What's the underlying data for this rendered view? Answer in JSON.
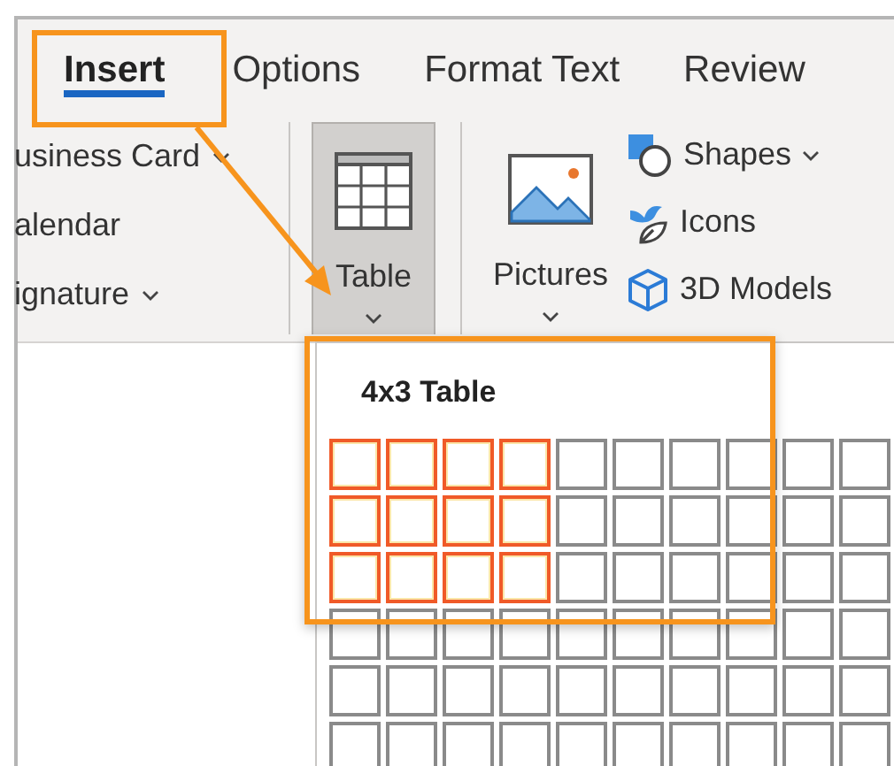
{
  "tabs": [
    {
      "label": "Insert",
      "selected": true
    },
    {
      "label": "Options",
      "selected": false
    },
    {
      "label": "Format Text",
      "selected": false
    },
    {
      "label": "Review",
      "selected": false
    }
  ],
  "left_group": [
    {
      "label": "usiness Card",
      "has_dropdown": true
    },
    {
      "label": "alendar",
      "has_dropdown": false
    },
    {
      "label": "ignature",
      "has_dropdown": true
    }
  ],
  "large_buttons": [
    {
      "label": "Table",
      "kind": "table",
      "pressed": true
    },
    {
      "label": "Pictures",
      "kind": "pictures",
      "pressed": false
    }
  ],
  "small_buttons": [
    {
      "label": "Shapes",
      "kind": "shapes",
      "has_dropdown": true
    },
    {
      "label": "Icons",
      "kind": "icons",
      "has_dropdown": false
    },
    {
      "label": "3D Models",
      "kind": "cube",
      "has_dropdown": false
    }
  ],
  "table_dropdown": {
    "title": "4x3 Table",
    "rows": [
      {
        "selected": [
          true,
          true,
          true,
          true,
          false,
          false,
          false,
          false,
          false,
          false
        ]
      },
      {
        "selected": [
          true,
          true,
          true,
          true,
          false,
          false,
          false,
          false,
          false,
          false
        ]
      },
      {
        "selected": [
          true,
          true,
          true,
          true,
          false,
          false,
          false,
          false,
          false,
          false
        ]
      },
      {
        "selected": [
          false,
          false,
          false,
          false,
          false,
          false,
          false,
          false,
          false,
          false
        ]
      },
      {
        "selected": [
          false,
          false,
          false,
          false,
          false,
          false,
          false,
          false,
          false,
          false
        ]
      },
      {
        "selected": [
          false,
          false,
          false,
          false,
          false,
          false,
          false,
          false,
          false,
          false
        ]
      }
    ]
  },
  "callouts": [
    {
      "kind": "frame"
    },
    {
      "kind": "arrow"
    },
    {
      "kind": "frame"
    }
  ]
}
